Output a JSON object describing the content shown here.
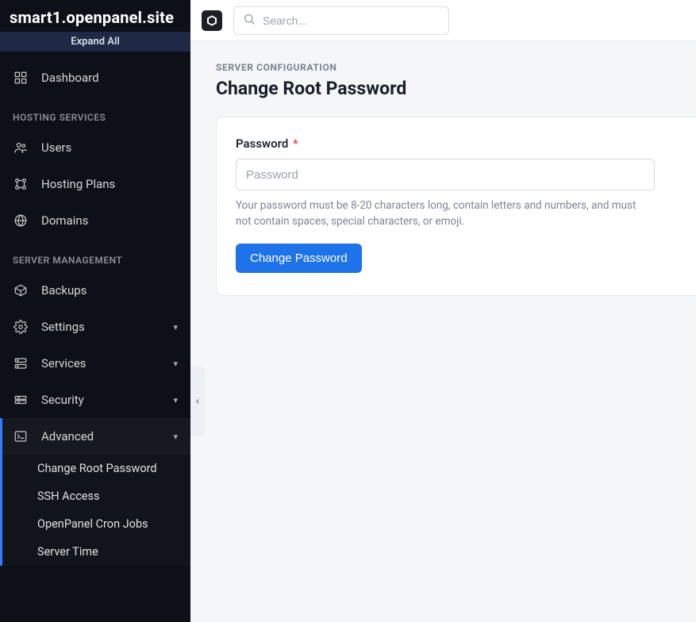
{
  "sidebar": {
    "site_title": "smart1.openpanel.site",
    "expand_all": "Expand All",
    "dashboard_label": "Dashboard",
    "section_hosting": "HOSTING SERVICES",
    "users_label": "Users",
    "plans_label": "Hosting Plans",
    "domains_label": "Domains",
    "section_server": "SERVER MANAGEMENT",
    "backups_label": "Backups",
    "settings_label": "Settings",
    "services_label": "Services",
    "security_label": "Security",
    "advanced_label": "Advanced",
    "advanced_sub": {
      "change_root_pw": "Change Root Password",
      "ssh_access": "SSH Access",
      "cron_jobs": "OpenPanel Cron Jobs",
      "server_time": "Server Time"
    }
  },
  "topbar": {
    "search_placeholder": "Search..."
  },
  "page": {
    "breadcrumb": "SERVER CONFIGURATION",
    "title": "Change Root Password"
  },
  "form": {
    "password_label": "Password",
    "required_mark": "*",
    "password_placeholder": "Password",
    "hint": "Your password must be 8-20 characters long, contain letters and numbers, and must not contain spaces, special characters, or emoji.",
    "submit_label": "Change Password"
  }
}
